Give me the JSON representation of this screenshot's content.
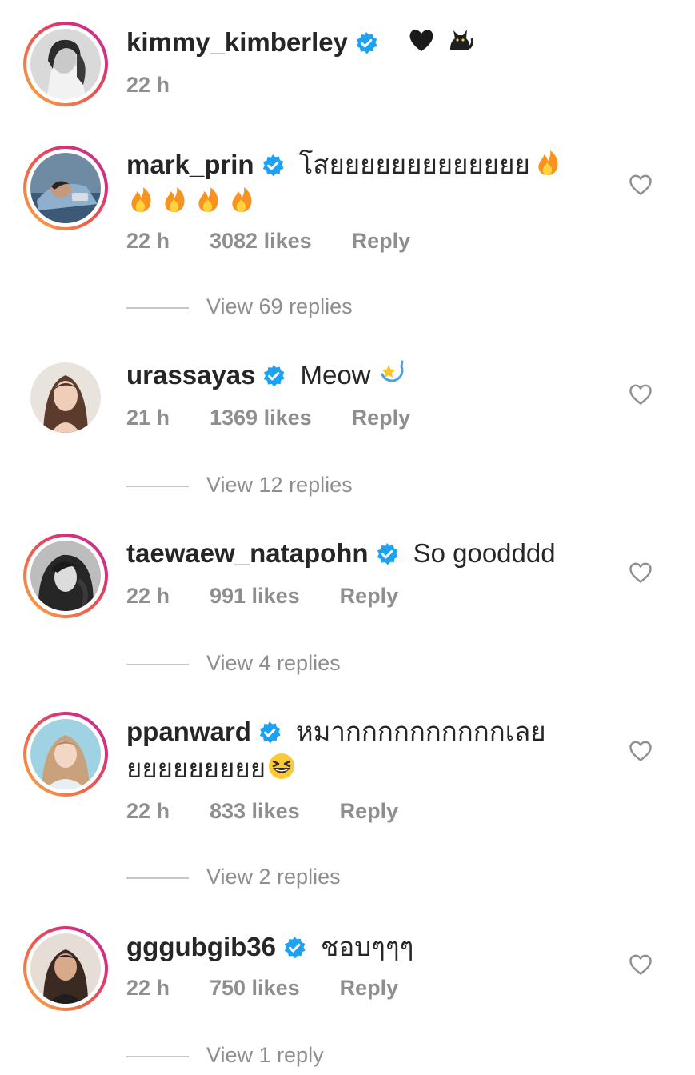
{
  "caption": {
    "username": "kimmy_kimberley",
    "text": "",
    "time": "22 h"
  },
  "comments": [
    {
      "username": "mark_prin",
      "text_line1": "โสยยยยยยยยยยยยย",
      "text_line2": "",
      "time": "22 h",
      "likes": "3082 likes",
      "reply_label": "Reply",
      "view_replies": "View 69 replies"
    },
    {
      "username": "urassayas",
      "text_line1": "Meow",
      "time": "21 h",
      "likes": "1369 likes",
      "reply_label": "Reply",
      "view_replies": "View 12 replies"
    },
    {
      "username": "taewaew_natapohn",
      "text_line1": "So goodddd",
      "time": "22 h",
      "likes": "991 likes",
      "reply_label": "Reply",
      "view_replies": "View 4 replies"
    },
    {
      "username": "ppanward",
      "text_line1": "หมากกกกกกกกกกเลย",
      "text_line2": "ยยยยยยยยย",
      "time": "22 h",
      "likes": "833 likes",
      "reply_label": "Reply",
      "view_replies": "View 2 replies"
    },
    {
      "username": "gggubgib36",
      "text_line1": "ชอบๆๆๆ",
      "time": "22 h",
      "likes": "750 likes",
      "reply_label": "Reply",
      "view_replies": "View 1 reply"
    }
  ],
  "colors": {
    "verified": "#1da1f2",
    "muted_text": "#8e8e8e",
    "story_ring_start": "#f6b146",
    "story_ring_end": "#b93ba0"
  },
  "icons": {
    "verified": "verified-badge-icon",
    "like": "heart-outline-icon",
    "caption_emoji": [
      "black-heart-emoji",
      "black-cat-emoji"
    ],
    "fire": "fire-emoji",
    "dizzy": "dizzy-star-emoji",
    "laugh": "grinning-squinting-face-emoji"
  }
}
